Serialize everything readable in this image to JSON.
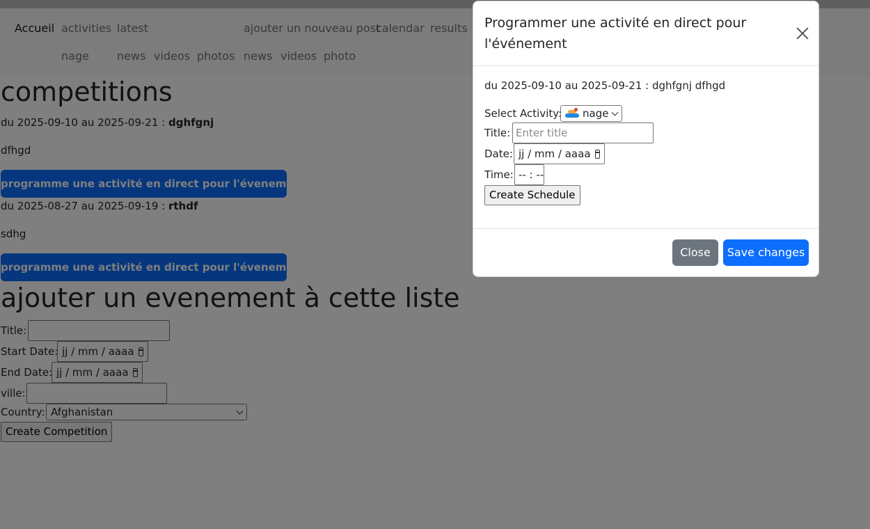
{
  "navbar": {
    "links": [
      {
        "label": "Accueil"
      },
      {
        "label": "activities"
      },
      {
        "label": "latest"
      },
      {
        "label": "ajouter un nouveau post"
      },
      {
        "label": "calendar"
      },
      {
        "label": "results"
      },
      {
        "label": "nage"
      },
      {
        "label": "news"
      },
      {
        "label": "videos"
      },
      {
        "label": "photos"
      },
      {
        "label": "news"
      },
      {
        "label": "videos"
      },
      {
        "label": "photo"
      }
    ]
  },
  "competitions": {
    "heading": "competitions",
    "events": [
      {
        "dates": "du 2025-09-10 au 2025-09-21 : ",
        "name": "dghfgnj",
        "description": "dfhgd",
        "button": "programme une activité en direct pour l'évenement"
      },
      {
        "dates": "du 2025-08-27 au 2025-09-19 : ",
        "name": "rthdf",
        "description": "sdhg",
        "button": "programme une activité en direct pour l'évenement"
      }
    ]
  },
  "add_form": {
    "heading": "ajouter un evenement à cette liste",
    "title_label": "Title:",
    "start_label": "Start Date:",
    "end_label": "End Date:",
    "date_placeholder": "jj / mm / aaaa",
    "ville_label": "ville:",
    "country_label": "Country:",
    "country_value": "Afghanistan",
    "submit": "Create Competition"
  },
  "modal": {
    "title": "Programmer une activité en direct pour l'événement",
    "event_line": "du 2025-09-10 au 2025-09-21 : dghfgnj dfhgd",
    "activity_label": "Select Activity:",
    "activity_value": "nage",
    "activity_icon": "swimmer-icon",
    "title_label": "Title:",
    "title_placeholder": "Enter title",
    "date_label": "Date:",
    "date_placeholder": "jj / mm / aaaa",
    "time_label": "Time:",
    "time_placeholder": "-- : --",
    "create_button": "Create Schedule",
    "close_button": "Close",
    "save_button": "Save changes"
  },
  "colors": {
    "primary": "#0d6efd",
    "secondary": "#6c757d",
    "navbar_bg": "#f8f9fa",
    "backdrop": "rgba(0,0,0,0.5)"
  }
}
